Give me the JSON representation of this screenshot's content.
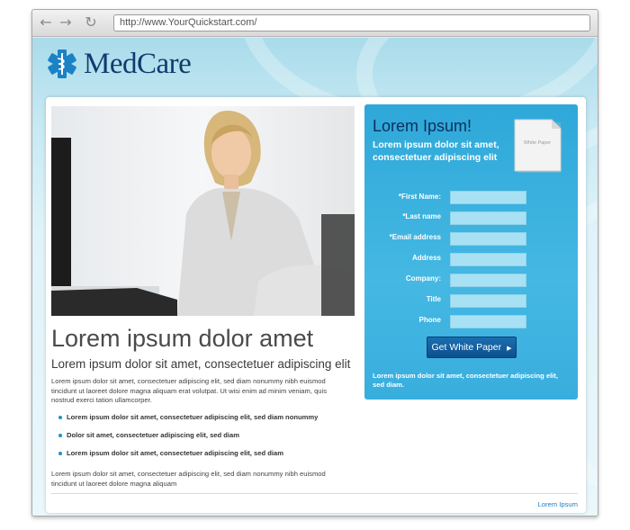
{
  "browser": {
    "back_icon": "left-arrow-icon",
    "forward_icon": "right-arrow-icon",
    "reload_icon": "reload-icon",
    "url": "http://www.YourQuickstart.com/"
  },
  "brand": {
    "name": "MedCare",
    "logo_icon": "medical-star-caduceus-icon",
    "color": "#0f3c6e"
  },
  "main": {
    "headline": "Lorem ipsum dolor amet",
    "subhead": "Lorem ipsum dolor sit amet, consectetuer adipiscing elit",
    "intro": "Lorem ipsum dolor sit amet, consectetuer adipiscing elit, sed diam nonummy nibh euismod tincidunt ut laoreet dolore magna aliquam erat volutpat. Ut wisi enim ad minim veniam, quis nostrud exerci tation ullamcorper.",
    "bullets": [
      "Lorem ipsum dolor sit amet, consectetuer adipiscing elit, sed diam nonummy",
      "Dolor sit amet, consectetuer adipiscing elit, sed diam",
      "Lorem ipsum dolor sit amet, consectetuer adipiscing elit, sed diam"
    ],
    "outro": "Lorem ipsum dolor sit amet, consectetuer adipiscing elit, sed diam nonummy nibh euismod tincidunt ut laoreet dolore magna aliquam"
  },
  "form": {
    "title": "Lorem Ipsum!",
    "subtitle": "Lorem ipsum dolor sit amet, consectetuer adipiscing elit",
    "paper_label": "White Paper",
    "fields": [
      {
        "label": "*First Name:",
        "value": ""
      },
      {
        "label": "*Last name",
        "value": ""
      },
      {
        "label": "*Email address",
        "value": ""
      },
      {
        "label": "Address",
        "value": ""
      },
      {
        "label": "Company:",
        "value": ""
      },
      {
        "label": "Title",
        "value": ""
      },
      {
        "label": "Phone",
        "value": ""
      }
    ],
    "submit_label": "Get White Paper",
    "submit_icon": "triangle-right-icon",
    "note": "Lorem ipsum dolor sit amet, consectetuer adipiscing elit, sed diam.",
    "accent": "#2ea8d9"
  },
  "footer": {
    "link": "Lorem Ipsum"
  }
}
